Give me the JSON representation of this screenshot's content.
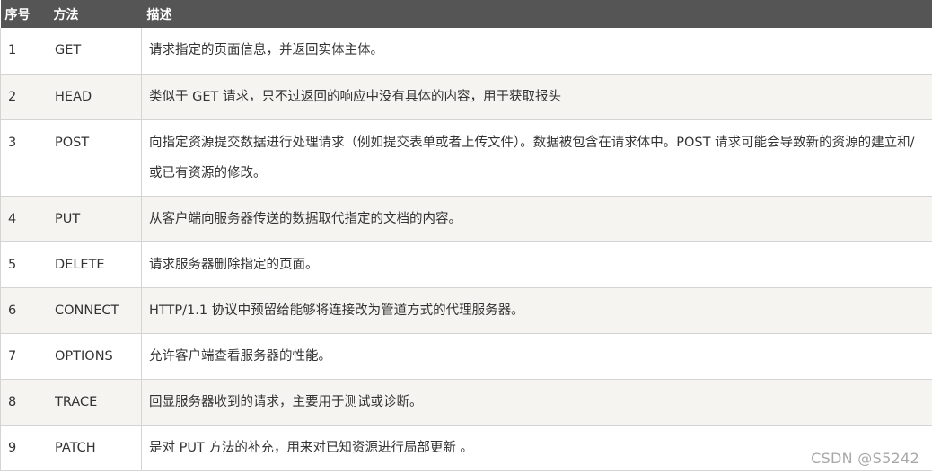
{
  "table": {
    "headers": {
      "num": "序号",
      "method": "方法",
      "desc": "描述"
    },
    "rows": [
      {
        "num": "1",
        "method": "GET",
        "desc": "请求指定的页面信息，并返回实体主体。"
      },
      {
        "num": "2",
        "method": "HEAD",
        "desc": "类似于 GET 请求，只不过返回的响应中没有具体的内容，用于获取报头"
      },
      {
        "num": "3",
        "method": "POST",
        "desc": "向指定资源提交数据进行处理请求（例如提交表单或者上传文件）。数据被包含在请求体中。POST 请求可能会导致新的资源的建立和/或已有资源的修改。"
      },
      {
        "num": "4",
        "method": "PUT",
        "desc": "从客户端向服务器传送的数据取代指定的文档的内容。"
      },
      {
        "num": "5",
        "method": "DELETE",
        "desc": "请求服务器删除指定的页面。"
      },
      {
        "num": "6",
        "method": "CONNECT",
        "desc": "HTTP/1.1 协议中预留给能够将连接改为管道方式的代理服务器。"
      },
      {
        "num": "7",
        "method": "OPTIONS",
        "desc": "允许客户端查看服务器的性能。"
      },
      {
        "num": "8",
        "method": "TRACE",
        "desc": "回显服务器收到的请求，主要用于测试或诊断。"
      },
      {
        "num": "9",
        "method": "PATCH",
        "desc": "是对 PUT 方法的补充，用来对已知资源进行局部更新 。"
      }
    ]
  },
  "watermark": "CSDN @S5242"
}
